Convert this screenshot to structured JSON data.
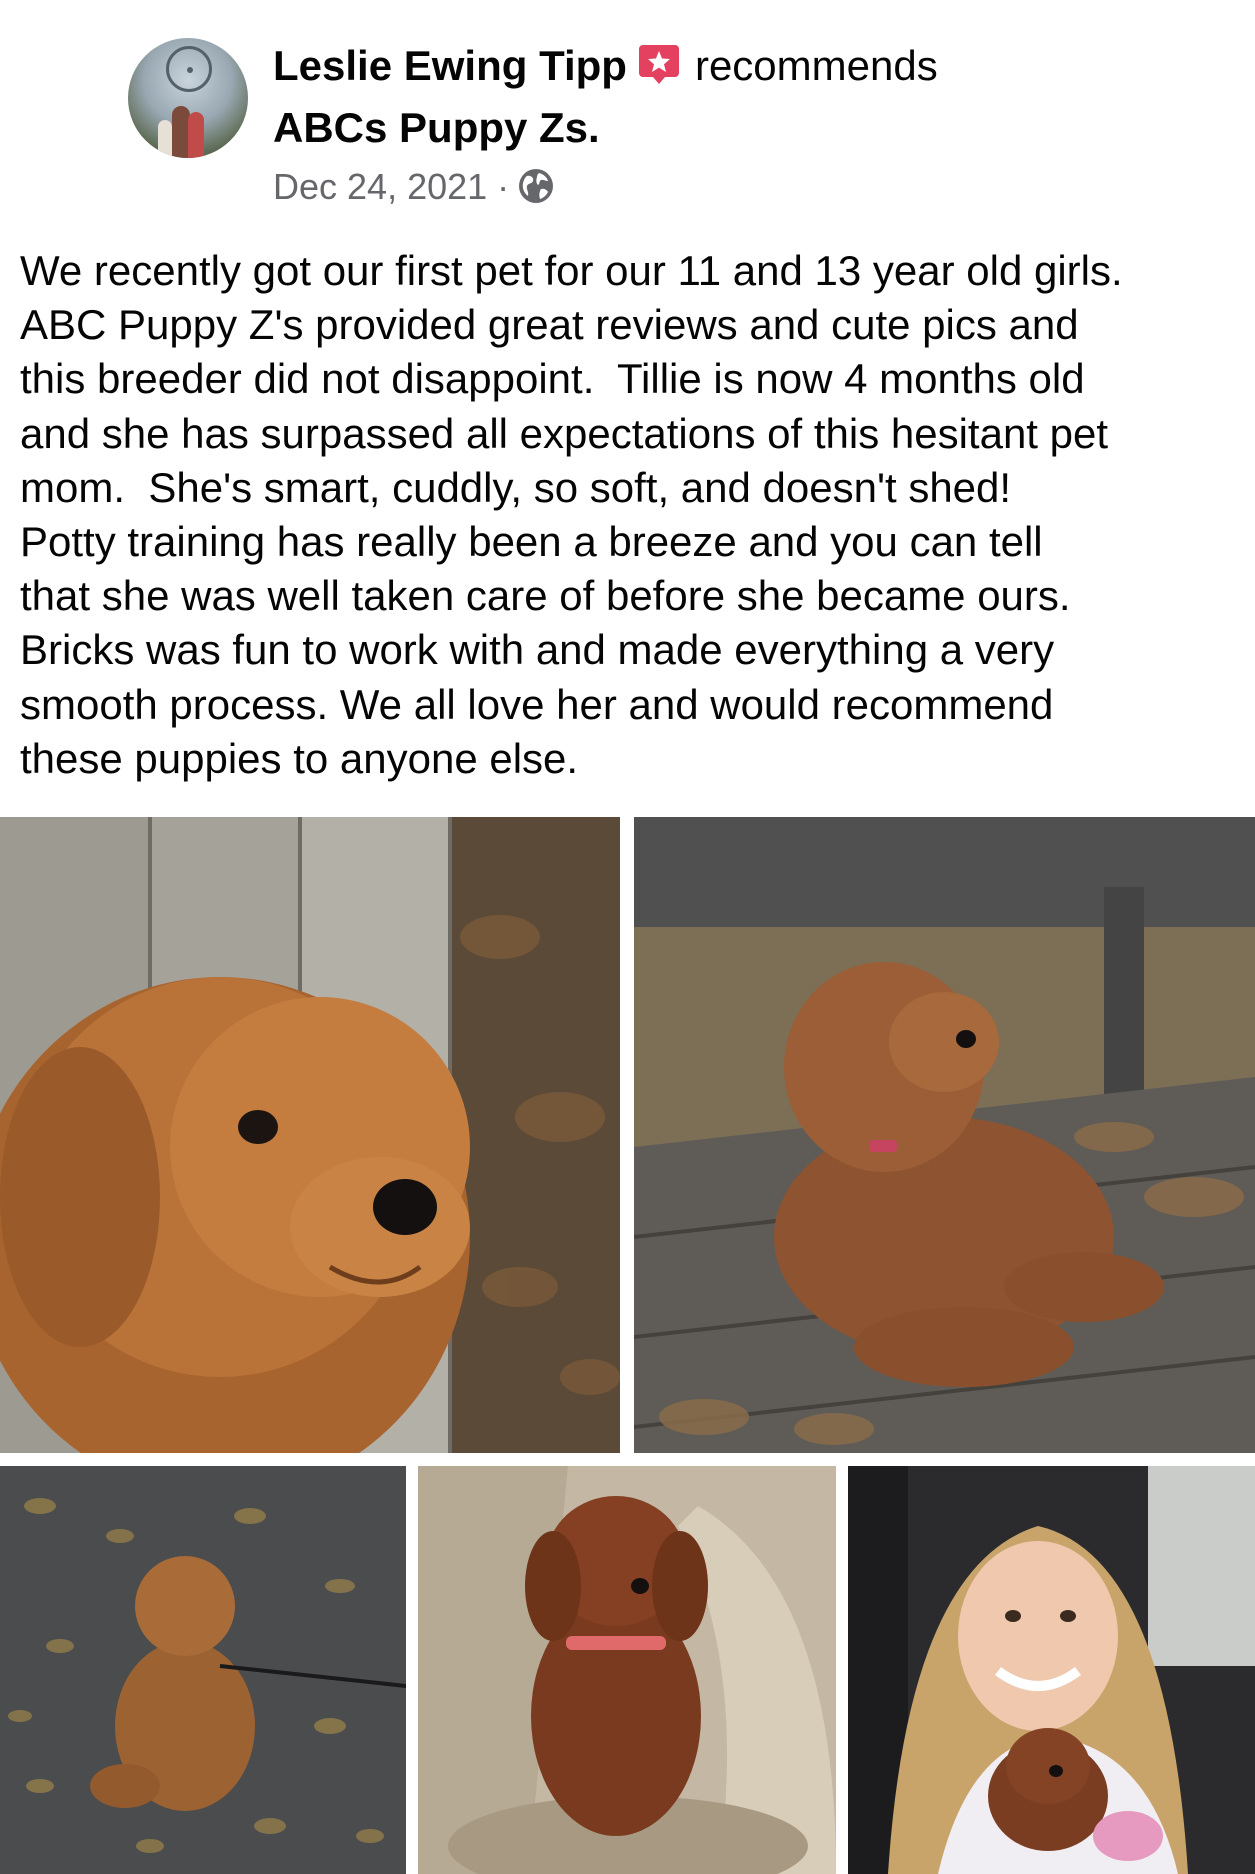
{
  "post": {
    "author": "Leslie Ewing Tipp",
    "action": "recommends",
    "page": "ABCs Puppy Zs.",
    "date": "Dec 24, 2021",
    "separator": "·",
    "audience_icon": "globe-icon",
    "recommend_icon": "recommend-star-icon",
    "text": "We recently got our first pet for our 11 and 13 year old girls.\nABC Puppy Z's provided great reviews and cute pics and\nthis breeder did not disappoint.  Tillie is now 4 months old\nand she has surpassed all expectations of this hesitant pet\nmom.  She's smart, cuddly, so soft, and doesn't shed!\nPotty training has really been a breeze and you can tell\nthat she was well taken care of before she became ours.\nBricks was fun to work with and made everything a very\nsmooth process. We all love her and would recommend\nthese puppies to anyone else."
  },
  "colors": {
    "accent_red": "#e4405f",
    "text_primary": "#050505",
    "text_secondary": "#65676b"
  },
  "photos": [
    {
      "name": "photo-puppy-closeup"
    },
    {
      "name": "photo-puppy-on-bench"
    },
    {
      "name": "photo-puppy-on-leaves"
    },
    {
      "name": "photo-puppy-on-cushion"
    },
    {
      "name": "photo-girl-holding-puppy"
    }
  ]
}
